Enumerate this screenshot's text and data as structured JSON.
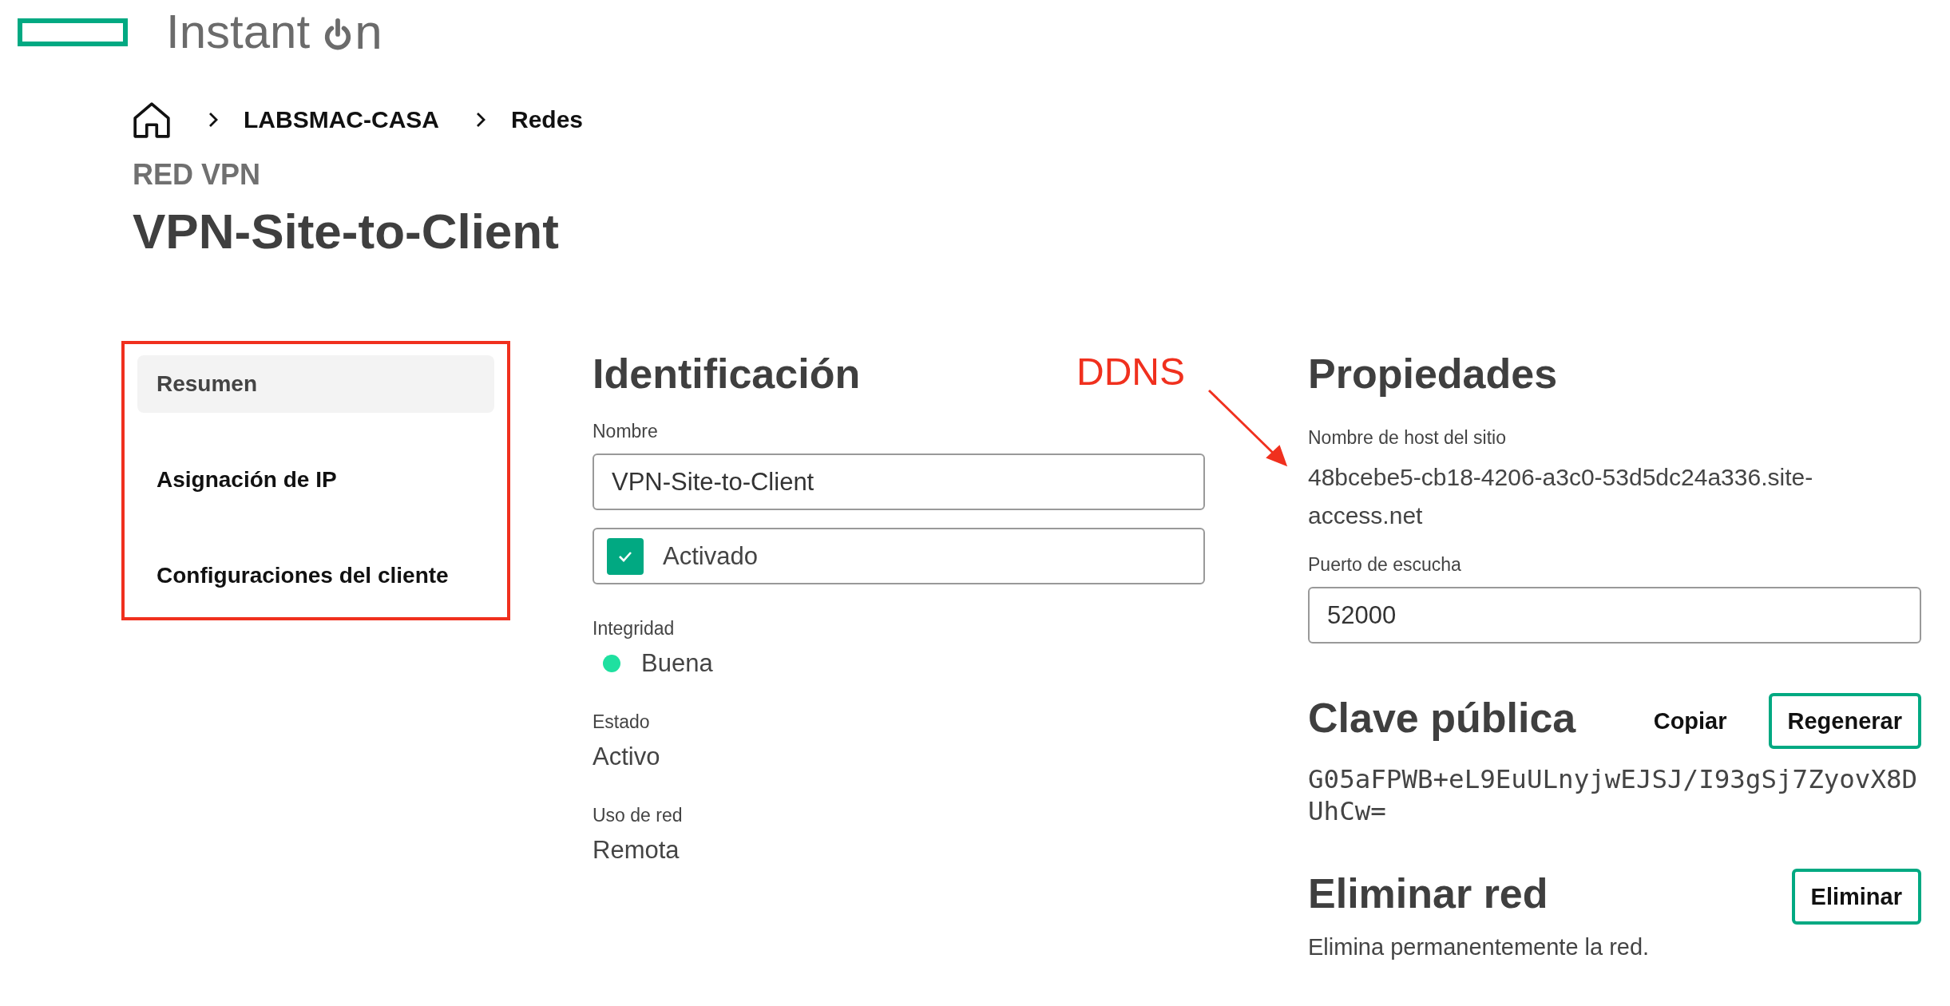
{
  "logo": {
    "text": "Instant",
    "suffix": "n"
  },
  "breadcrumb": [
    "LABSMAC-CASA",
    "Redes"
  ],
  "eyebrow": "RED VPN",
  "title": "VPN-Site-to-Client",
  "sidebar": {
    "highlighted": true,
    "items": [
      {
        "label": "Resumen",
        "selected": true
      },
      {
        "label": "Asignación de IP",
        "selected": false
      },
      {
        "label": "Configuraciones del cliente",
        "selected": false
      }
    ]
  },
  "identification": {
    "heading": "Identificación",
    "name_label": "Nombre",
    "name_value": "VPN-Site-to-Client",
    "enabled": {
      "label": "Activado",
      "checked": true
    },
    "integrity": {
      "label": "Integridad",
      "value": "Buena",
      "color": "#1fe0a0"
    },
    "fields": [
      {
        "label": "Estado",
        "value": "Activo"
      },
      {
        "label": "Uso de red",
        "value": "Remota"
      }
    ]
  },
  "annotation": {
    "label": "DDNS"
  },
  "properties": {
    "heading": "Propiedades",
    "host_label": "Nombre de host del sitio",
    "host_value": "48bcebe5-cb18-4206-a3c0-53d5dc24a336.site-access.net",
    "port_label": "Puerto de escucha",
    "port_value": "52000"
  },
  "public_key": {
    "heading": "Clave pública",
    "copy": "Copiar",
    "regenerate": "Regenerar",
    "value": "G05aFPWB+eL9EuULnyjwEJSJ/I93gSj7ZyovX8DUhCw="
  },
  "delete": {
    "heading": "Eliminar red",
    "button": "Eliminar",
    "description": "Elimina permanentemente la red."
  }
}
